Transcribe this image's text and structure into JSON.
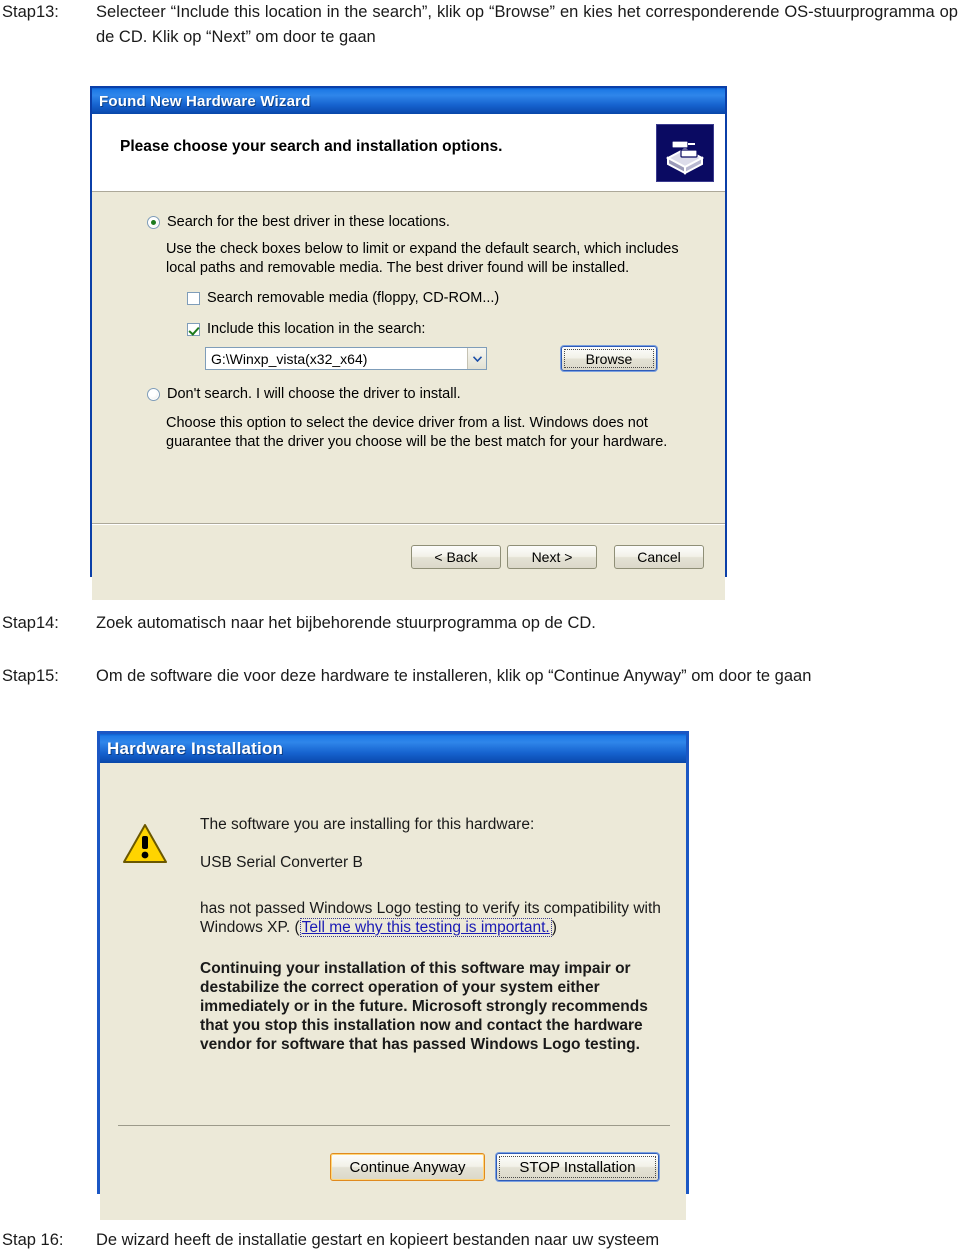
{
  "document": {
    "steps": [
      {
        "id": "step13",
        "label": "Stap13:",
        "text": "Selecteer “Include this location in the search”, klik op “Browse” en kies het corresponderende OS-stuurprogramma op de CD. Klik op “Next” om door te gaan"
      },
      {
        "id": "step14",
        "label": "Stap14:",
        "text": "Zoek automatisch naar het bijbehorende stuurprogramma op de CD."
      },
      {
        "id": "step15",
        "label": "Stap15:",
        "text": "Om de software die voor deze hardware te installeren, klik op “Continue Anyway” om door te gaan"
      },
      {
        "id": "step16",
        "label": "Stap 16:",
        "text": "De wizard heeft de installatie gestart en kopieert bestanden naar uw systeem"
      }
    ]
  },
  "wizard_dialog": {
    "title": "Found New Hardware Wizard",
    "header_text": "Please choose your search and installation options.",
    "header_icon": "wizard-hardware-icon",
    "option_search": {
      "label": "Search for the best driver in these locations.",
      "underlined_letter": "S",
      "selected": true
    },
    "search_description": "Use the check boxes below to limit or expand the default search, which includes local paths and removable media. The best driver found will be installed.",
    "checkbox_removable": {
      "label": "Search removable media (floppy, CD-ROM...)",
      "checked": false
    },
    "checkbox_include_location": {
      "label": "Include this location in the search:",
      "checked": true
    },
    "location_combo": {
      "value": "G:\\Winxp_vista(x32_x64)",
      "arrow_icon": "chevron-down-icon"
    },
    "browse_button": {
      "label": "Browse",
      "state": "focused"
    },
    "option_dont_search": {
      "label": "Don't search. I will choose the driver to install.",
      "selected": false
    },
    "dont_search_description": "Choose this option to select the device driver from a list.  Windows does not guarantee that the driver you choose will be the best match for your hardware.",
    "buttons": {
      "back": "< Back",
      "next": "Next >",
      "cancel": "Cancel"
    }
  },
  "hardware_installation_dialog": {
    "title": "Hardware Installation",
    "icon": "warning-triangle-icon",
    "intro": "The software you are installing for this hardware:",
    "device_name": "USB Serial Converter B",
    "warning_line_1": "has not passed Windows Logo testing to verify its compatibility",
    "warning_line_2_prefix": "with Windows XP. (",
    "warning_link": "Tell me why this testing is important.",
    "warning_line_2_suffix": ")",
    "bold_warning": "Continuing your installation of this software may impair or destabilize the correct operation of your system either immediately or in the future. Microsoft strongly recommends that you stop this installation now and contact the hardware vendor for software that has passed Windows Logo testing.",
    "buttons": {
      "continue_anyway": "Continue Anyway",
      "stop_installation": "STOP Installation"
    }
  },
  "colors": {
    "titlebar_blue": "#1f7ae6",
    "dialog_face": "#ece9d8",
    "link_blue": "#1a1ab4",
    "warning_yellow": "#ffd400",
    "radio_green": "#1c7a1c",
    "hot_orange": "#e08a1e"
  }
}
